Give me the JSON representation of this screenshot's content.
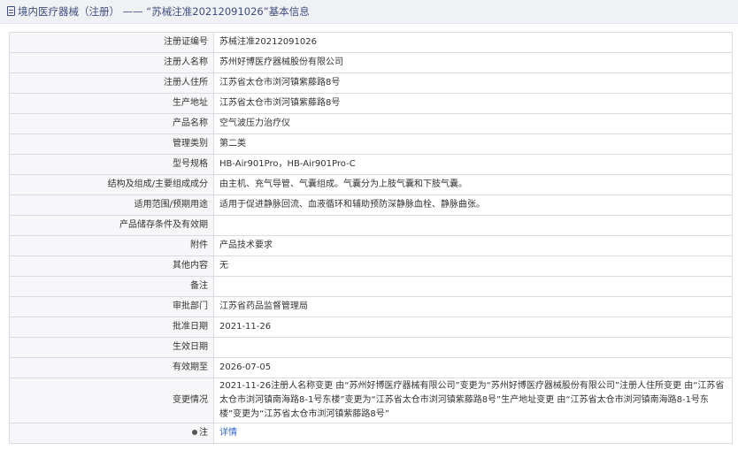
{
  "header": {
    "title": "境内医疗器械（注册） —— “苏械注准20212091026”基本信息",
    "doc_icon": "document-icon"
  },
  "rows": [
    {
      "label": "注册证编号",
      "value": "苏械注准20212091026"
    },
    {
      "label": "注册人名称",
      "value": "苏州好博医疗器械股份有限公司"
    },
    {
      "label": "注册人住所",
      "value": "江苏省太仓市浏河镇紫藤路8号"
    },
    {
      "label": "生产地址",
      "value": "江苏省太仓市浏河镇紫藤路8号"
    },
    {
      "label": "产品名称",
      "value": "空气波压力治疗仪"
    },
    {
      "label": "管理类别",
      "value": "第二类"
    },
    {
      "label": "型号规格",
      "value": "HB-Air901Pro，HB-Air901Pro-C"
    },
    {
      "label": "结构及组成/主要组成成分",
      "value": "由主机、充气导管、气囊组成。气囊分为上肢气囊和下肢气囊。"
    },
    {
      "label": "适用范围/预期用途",
      "value": "适用于促进静脉回流、血液循环和辅助预防深静脉血栓、静脉曲张。"
    },
    {
      "label": "产品储存条件及有效期",
      "value": ""
    },
    {
      "label": "附件",
      "value": "产品技术要求"
    },
    {
      "label": "其他内容",
      "value": "无"
    },
    {
      "label": "备注",
      "value": ""
    },
    {
      "label": "审批部门",
      "value": "江苏省药品监督管理局"
    },
    {
      "label": "批准日期",
      "value": "2021-11-26"
    },
    {
      "label": "生效日期",
      "value": ""
    },
    {
      "label": "有效期至",
      "value": "2026-07-05"
    },
    {
      "label": "变更情况",
      "value": "2021-11-26注册人名称变更 由“苏州好博医疗器械有限公司”变更为“苏州好博医疗器械股份有限公司”注册人住所变更 由“江苏省太仓市浏河镇南海路8-1号东楼”变更为“江苏省太仓市浏河镇紫藤路8号”生产地址变更 由“江苏省太仓市浏河镇南海路8-1号东楼”变更为“江苏省太仓市浏河镇紫藤路8号”"
    }
  ],
  "note_row": {
    "label": "注",
    "link": "详情",
    "icon": "note-icon"
  }
}
